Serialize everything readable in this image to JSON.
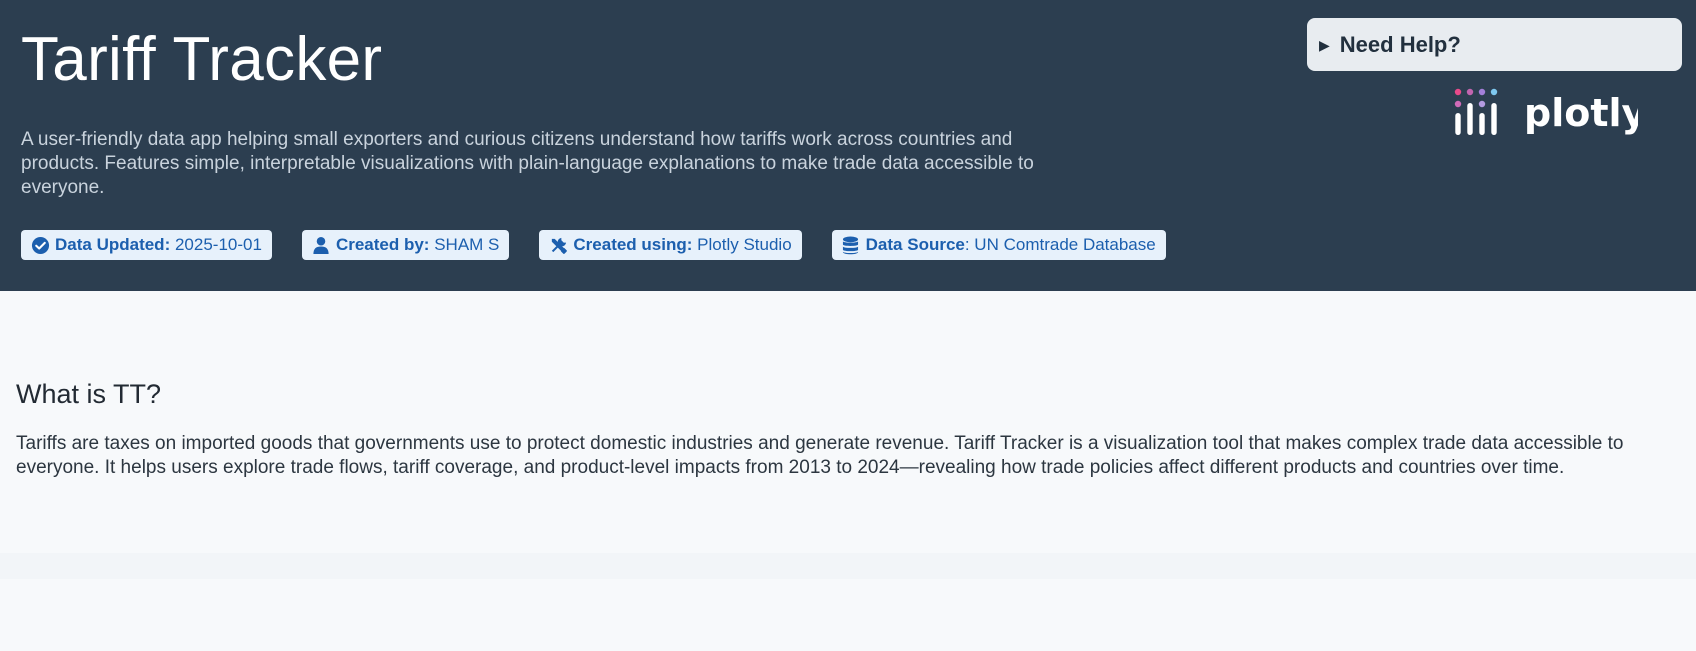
{
  "header": {
    "title": "Tariff Tracker",
    "subtitle": "A user-friendly data app helping small exporters and curious citizens understand how tariffs work across countries and products. Features simple, interpretable visualizations with plain-language explanations to make trade data accessible to everyone.",
    "badges": [
      {
        "icon": "check-circle-icon",
        "label": "Data Updated:",
        "value": "2025-10-01"
      },
      {
        "icon": "user-icon",
        "label": "Created by:",
        "value": "SHAM S"
      },
      {
        "icon": "tools-icon",
        "label": "Created using:",
        "value": "Plotly Studio"
      },
      {
        "icon": "database-icon",
        "label": "Data Source",
        "value": ": UN Comtrade Database"
      }
    ],
    "help_label": "Need Help?",
    "logo_text": "plotly"
  },
  "main": {
    "section_title": "What is TT?",
    "section_body": "Tariffs are taxes on imported goods that governments use to protect domestic industries and generate revenue. Tariff Tracker is a visualization tool that makes complex trade data accessible to everyone. It helps users explore trade flows, tariff coverage, and product-level impacts from 2013 to 2024—revealing how trade policies affect different products and countries over time."
  },
  "colors": {
    "header_bg": "#2c3e50",
    "badge_bg": "#e7f1fb",
    "badge_text": "#1c5fae",
    "page_bg": "#f7f9fb",
    "logo_dot_pink": "#e84a8a",
    "logo_dot_purple": "#a37fd9",
    "logo_dot_blue": "#7fc8f0"
  }
}
